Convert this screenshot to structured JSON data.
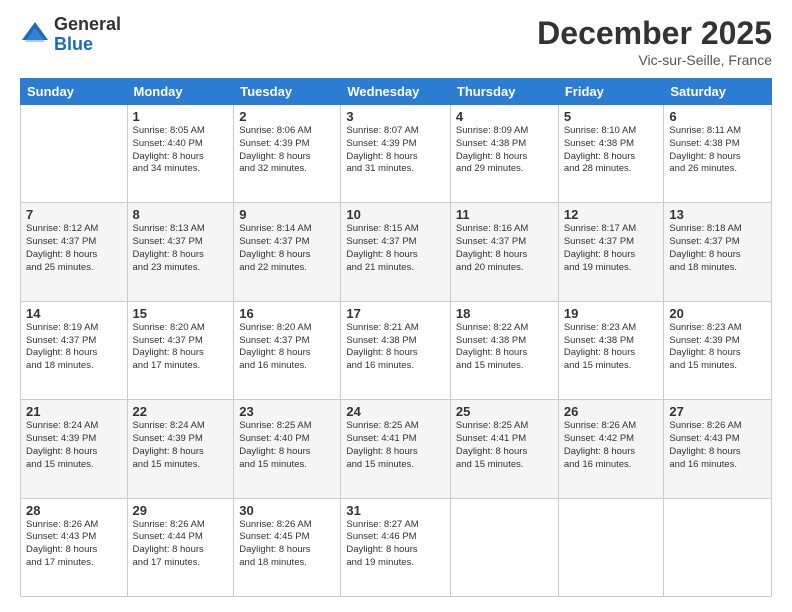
{
  "logo": {
    "general": "General",
    "blue": "Blue"
  },
  "header": {
    "month": "December 2025",
    "location": "Vic-sur-Seille, France"
  },
  "weekdays": [
    "Sunday",
    "Monday",
    "Tuesday",
    "Wednesday",
    "Thursday",
    "Friday",
    "Saturday"
  ],
  "weeks": [
    [
      {
        "day": "",
        "info": ""
      },
      {
        "day": "1",
        "info": "Sunrise: 8:05 AM\nSunset: 4:40 PM\nDaylight: 8 hours\nand 34 minutes."
      },
      {
        "day": "2",
        "info": "Sunrise: 8:06 AM\nSunset: 4:39 PM\nDaylight: 8 hours\nand 32 minutes."
      },
      {
        "day": "3",
        "info": "Sunrise: 8:07 AM\nSunset: 4:39 PM\nDaylight: 8 hours\nand 31 minutes."
      },
      {
        "day": "4",
        "info": "Sunrise: 8:09 AM\nSunset: 4:38 PM\nDaylight: 8 hours\nand 29 minutes."
      },
      {
        "day": "5",
        "info": "Sunrise: 8:10 AM\nSunset: 4:38 PM\nDaylight: 8 hours\nand 28 minutes."
      },
      {
        "day": "6",
        "info": "Sunrise: 8:11 AM\nSunset: 4:38 PM\nDaylight: 8 hours\nand 26 minutes."
      }
    ],
    [
      {
        "day": "7",
        "info": "Sunrise: 8:12 AM\nSunset: 4:37 PM\nDaylight: 8 hours\nand 25 minutes."
      },
      {
        "day": "8",
        "info": "Sunrise: 8:13 AM\nSunset: 4:37 PM\nDaylight: 8 hours\nand 23 minutes."
      },
      {
        "day": "9",
        "info": "Sunrise: 8:14 AM\nSunset: 4:37 PM\nDaylight: 8 hours\nand 22 minutes."
      },
      {
        "day": "10",
        "info": "Sunrise: 8:15 AM\nSunset: 4:37 PM\nDaylight: 8 hours\nand 21 minutes."
      },
      {
        "day": "11",
        "info": "Sunrise: 8:16 AM\nSunset: 4:37 PM\nDaylight: 8 hours\nand 20 minutes."
      },
      {
        "day": "12",
        "info": "Sunrise: 8:17 AM\nSunset: 4:37 PM\nDaylight: 8 hours\nand 19 minutes."
      },
      {
        "day": "13",
        "info": "Sunrise: 8:18 AM\nSunset: 4:37 PM\nDaylight: 8 hours\nand 18 minutes."
      }
    ],
    [
      {
        "day": "14",
        "info": "Sunrise: 8:19 AM\nSunset: 4:37 PM\nDaylight: 8 hours\nand 18 minutes."
      },
      {
        "day": "15",
        "info": "Sunrise: 8:20 AM\nSunset: 4:37 PM\nDaylight: 8 hours\nand 17 minutes."
      },
      {
        "day": "16",
        "info": "Sunrise: 8:20 AM\nSunset: 4:37 PM\nDaylight: 8 hours\nand 16 minutes."
      },
      {
        "day": "17",
        "info": "Sunrise: 8:21 AM\nSunset: 4:38 PM\nDaylight: 8 hours\nand 16 minutes."
      },
      {
        "day": "18",
        "info": "Sunrise: 8:22 AM\nSunset: 4:38 PM\nDaylight: 8 hours\nand 15 minutes."
      },
      {
        "day": "19",
        "info": "Sunrise: 8:23 AM\nSunset: 4:38 PM\nDaylight: 8 hours\nand 15 minutes."
      },
      {
        "day": "20",
        "info": "Sunrise: 8:23 AM\nSunset: 4:39 PM\nDaylight: 8 hours\nand 15 minutes."
      }
    ],
    [
      {
        "day": "21",
        "info": "Sunrise: 8:24 AM\nSunset: 4:39 PM\nDaylight: 8 hours\nand 15 minutes."
      },
      {
        "day": "22",
        "info": "Sunrise: 8:24 AM\nSunset: 4:39 PM\nDaylight: 8 hours\nand 15 minutes."
      },
      {
        "day": "23",
        "info": "Sunrise: 8:25 AM\nSunset: 4:40 PM\nDaylight: 8 hours\nand 15 minutes."
      },
      {
        "day": "24",
        "info": "Sunrise: 8:25 AM\nSunset: 4:41 PM\nDaylight: 8 hours\nand 15 minutes."
      },
      {
        "day": "25",
        "info": "Sunrise: 8:25 AM\nSunset: 4:41 PM\nDaylight: 8 hours\nand 15 minutes."
      },
      {
        "day": "26",
        "info": "Sunrise: 8:26 AM\nSunset: 4:42 PM\nDaylight: 8 hours\nand 16 minutes."
      },
      {
        "day": "27",
        "info": "Sunrise: 8:26 AM\nSunset: 4:43 PM\nDaylight: 8 hours\nand 16 minutes."
      }
    ],
    [
      {
        "day": "28",
        "info": "Sunrise: 8:26 AM\nSunset: 4:43 PM\nDaylight: 8 hours\nand 17 minutes."
      },
      {
        "day": "29",
        "info": "Sunrise: 8:26 AM\nSunset: 4:44 PM\nDaylight: 8 hours\nand 17 minutes."
      },
      {
        "day": "30",
        "info": "Sunrise: 8:26 AM\nSunset: 4:45 PM\nDaylight: 8 hours\nand 18 minutes."
      },
      {
        "day": "31",
        "info": "Sunrise: 8:27 AM\nSunset: 4:46 PM\nDaylight: 8 hours\nand 19 minutes."
      },
      {
        "day": "",
        "info": ""
      },
      {
        "day": "",
        "info": ""
      },
      {
        "day": "",
        "info": ""
      }
    ]
  ]
}
